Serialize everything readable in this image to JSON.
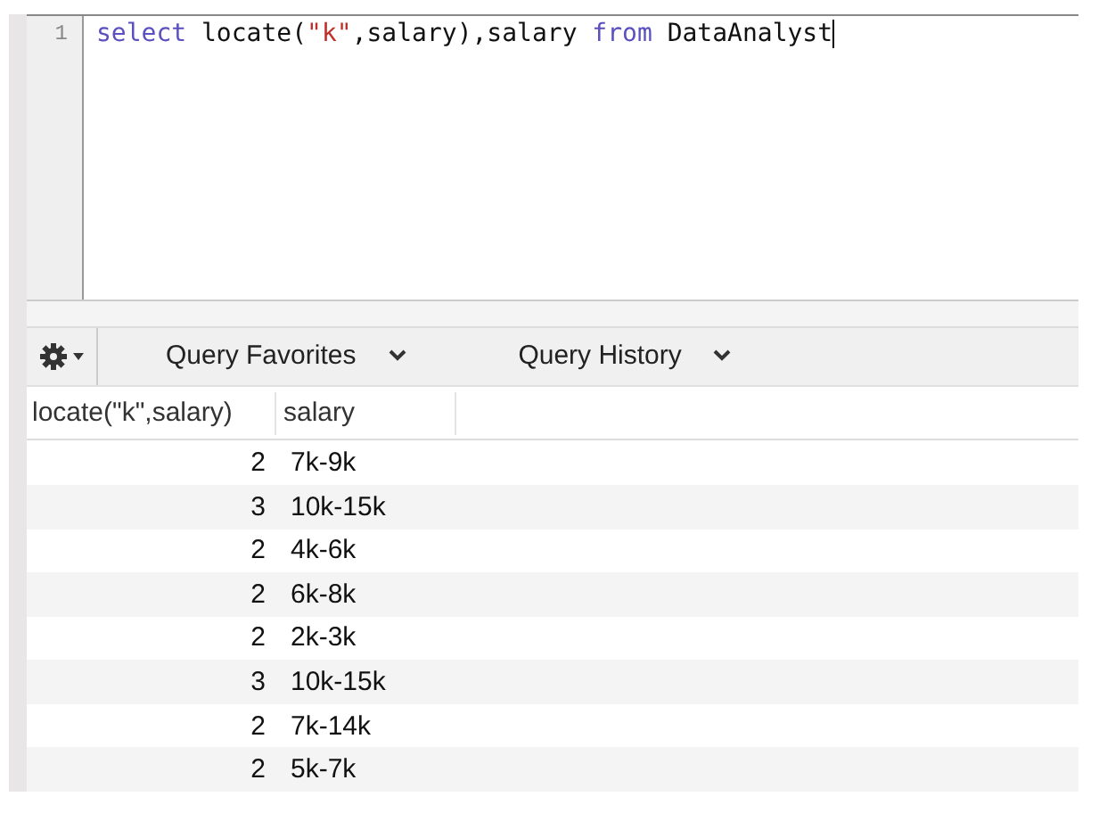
{
  "editor": {
    "line_number": "1",
    "tokens": [
      {
        "kind": "keyword",
        "text": "select"
      },
      {
        "kind": "plain",
        "text": " locate("
      },
      {
        "kind": "string",
        "text": "\"k\""
      },
      {
        "kind": "plain",
        "text": ",salary),salary "
      },
      {
        "kind": "keyword",
        "text": "from"
      },
      {
        "kind": "plain",
        "text": " DataAnalyst"
      }
    ]
  },
  "toolbar": {
    "favorites": "Query Favorites",
    "history": "Query History"
  },
  "table": {
    "columns": [
      "locate(\"k\",salary)",
      "salary"
    ],
    "rows": [
      [
        "2",
        "7k-9k"
      ],
      [
        "3",
        "10k-15k"
      ],
      [
        "2",
        "4k-6k"
      ],
      [
        "2",
        "6k-8k"
      ],
      [
        "2",
        "2k-3k"
      ],
      [
        "3",
        "10k-15k"
      ],
      [
        "2",
        "7k-14k"
      ],
      [
        "2",
        "5k-7k"
      ]
    ]
  }
}
